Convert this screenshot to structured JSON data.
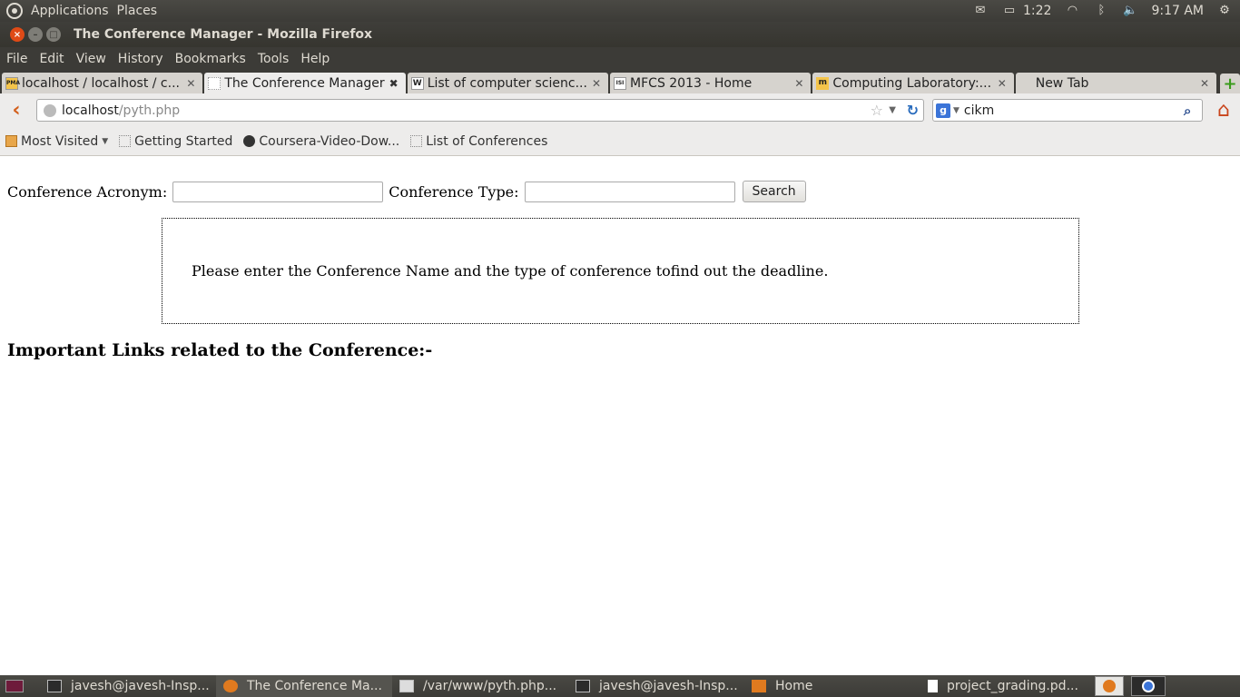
{
  "system_panel": {
    "menus": [
      "Applications",
      "Places"
    ],
    "battery_time": "1:22",
    "clock": "9:17 AM"
  },
  "window": {
    "title": "The Conference Manager - Mozilla Firefox"
  },
  "menu_bar": [
    "File",
    "Edit",
    "View",
    "History",
    "Bookmarks",
    "Tools",
    "Help"
  ],
  "tabs": [
    {
      "label": "localhost / localhost / c...",
      "favicon": "PMA"
    },
    {
      "label": "The Conference Manager",
      "favicon": ""
    },
    {
      "label": "List of computer scienc...",
      "favicon": "W"
    },
    {
      "label": "MFCS 2013 - Home",
      "favicon": "ISI"
    },
    {
      "label": "Computing Laboratory:...",
      "favicon": "m"
    },
    {
      "label": "New Tab",
      "favicon": ""
    }
  ],
  "url": {
    "host": "localhost",
    "path": "/pyth.php"
  },
  "search": {
    "engine": "g",
    "value": "cikm"
  },
  "bookmarks": [
    "Most Visited",
    "Getting Started",
    "Coursera-Video-Dow...",
    "List of Conferences"
  ],
  "page": {
    "acronym_label": "Conference Acronym:",
    "acronym_value": "",
    "type_label": "Conference Type:",
    "type_value": "",
    "search_button": "Search",
    "info_message": "Please enter the Conference Name and the type of conference tofind out the deadline.",
    "links_heading": "Important Links related to the Conference:-"
  },
  "taskbar": [
    {
      "label": "javesh@javesh-Insp...",
      "icon": "terminal"
    },
    {
      "label": "The Conference Ma...",
      "icon": "firefox"
    },
    {
      "label": "/var/www/pyth.php...",
      "icon": "editor"
    },
    {
      "label": "javesh@javesh-Insp...",
      "icon": "terminal"
    },
    {
      "label": "Home",
      "icon": "folder"
    },
    {
      "label": "project_grading.pd...",
      "icon": "document"
    }
  ]
}
